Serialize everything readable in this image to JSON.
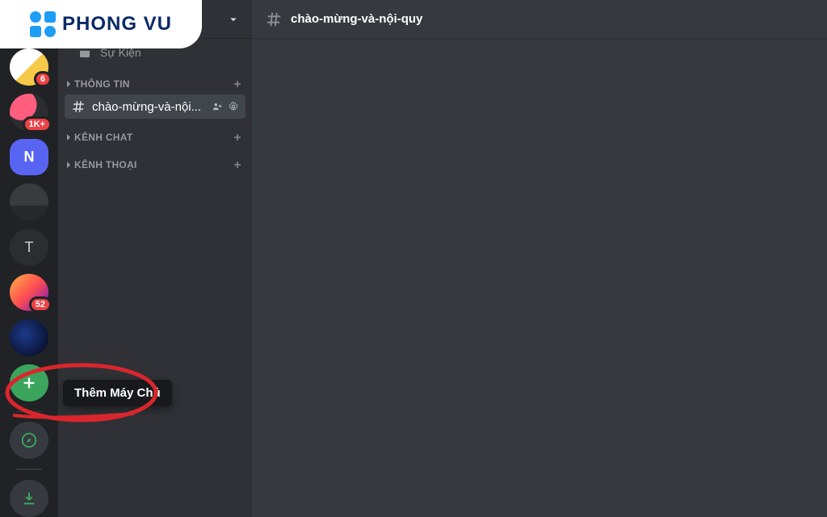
{
  "logo_text": "PHONG VU",
  "current_channel": "chào-mừng-và-nội-quy",
  "tooltip_add_server": "Thêm Máy Chủ",
  "sidebar": {
    "event_label": "Sự Kiện",
    "categories": [
      {
        "name": "THÔNG TIN"
      },
      {
        "name": "KÊNH CHAT"
      },
      {
        "name": "KÊNH THOẠI"
      }
    ],
    "active_channel_short": "chào-mừng-và-nội..."
  },
  "servers": [
    {
      "letter": "",
      "badge": "6"
    },
    {
      "letter": "",
      "badge": "1K+"
    },
    {
      "letter": "N",
      "badge": ""
    },
    {
      "letter": "",
      "badge": ""
    },
    {
      "letter": "T",
      "badge": ""
    },
    {
      "letter": "",
      "badge": "52"
    },
    {
      "letter": "",
      "badge": ""
    }
  ]
}
